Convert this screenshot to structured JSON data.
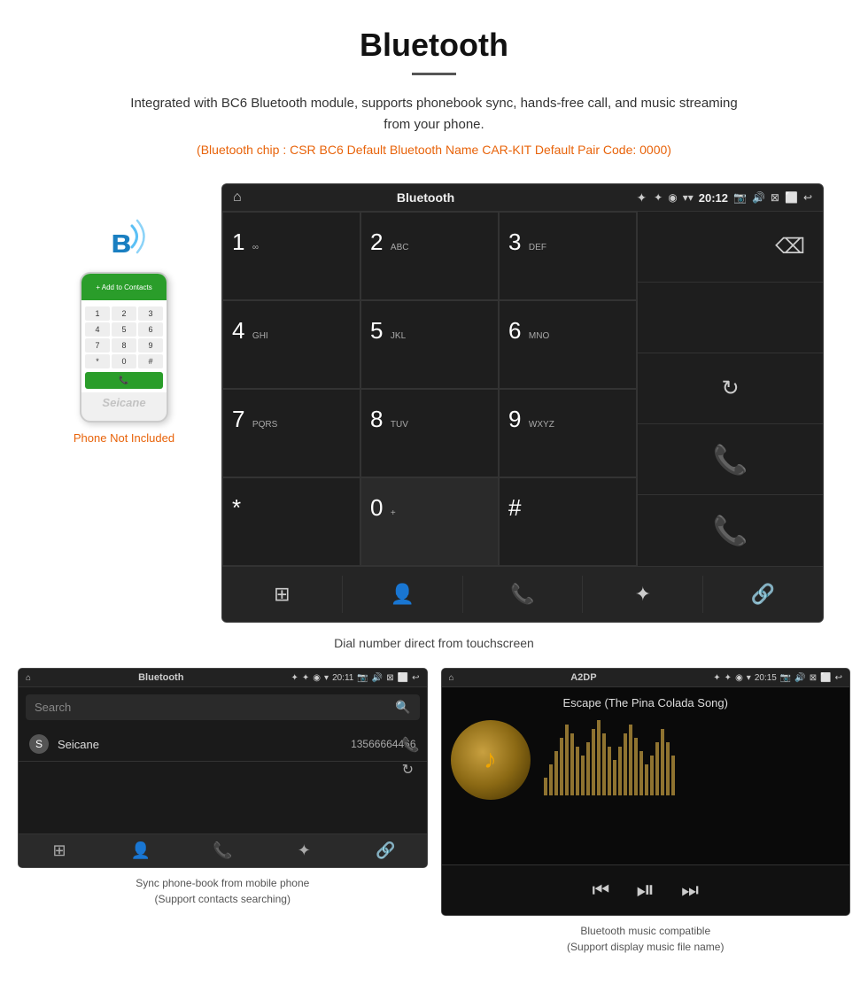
{
  "page": {
    "title": "Bluetooth",
    "divider": true,
    "description": "Integrated with BC6 Bluetooth module, supports phonebook sync, hands-free call, and music streaming from your phone.",
    "specs": "(Bluetooth chip : CSR BC6    Default Bluetooth Name CAR-KIT    Default Pair Code: 0000)"
  },
  "main_screen": {
    "statusbar": {
      "app_name": "Bluetooth",
      "usb_symbol": "✦",
      "time": "20:12",
      "icons": [
        "✦",
        "◉",
        "▾",
        "📷",
        "🔊",
        "⬜",
        "⬛",
        "↩"
      ]
    },
    "dial_keys": [
      {
        "number": "1",
        "letters": "∞"
      },
      {
        "number": "2",
        "letters": "ABC"
      },
      {
        "number": "3",
        "letters": "DEF"
      },
      {
        "number": "4",
        "letters": "GHI"
      },
      {
        "number": "5",
        "letters": "JKL"
      },
      {
        "number": "6",
        "letters": "MNO"
      },
      {
        "number": "7",
        "letters": "PQRS"
      },
      {
        "number": "8",
        "letters": "TUV"
      },
      {
        "number": "9",
        "letters": "WXYZ"
      },
      {
        "number": "*",
        "letters": ""
      },
      {
        "number": "0",
        "letters": "+"
      },
      {
        "number": "#",
        "letters": ""
      }
    ],
    "caption": "Dial number direct from touchscreen"
  },
  "phone_side": {
    "not_included": "Phone Not Included"
  },
  "phonebook_screen": {
    "statusbar_title": "Bluetooth",
    "time": "20:11",
    "search_placeholder": "Search",
    "contacts": [
      {
        "letter": "S",
        "name": "Seicane",
        "number": "13566664466"
      }
    ],
    "caption_line1": "Sync phone-book from mobile phone",
    "caption_line2": "(Support contacts searching)"
  },
  "music_screen": {
    "statusbar_title": "A2DP",
    "time": "20:15",
    "song_title": "Escape (The Pina Colada Song)",
    "viz_bars": [
      20,
      35,
      50,
      65,
      80,
      70,
      55,
      45,
      60,
      75,
      85,
      70,
      55,
      40,
      55,
      70,
      80,
      65,
      50,
      35,
      45,
      60,
      75,
      60,
      45
    ],
    "caption_line1": "Bluetooth music compatible",
    "caption_line2": "(Support display music file name)"
  }
}
